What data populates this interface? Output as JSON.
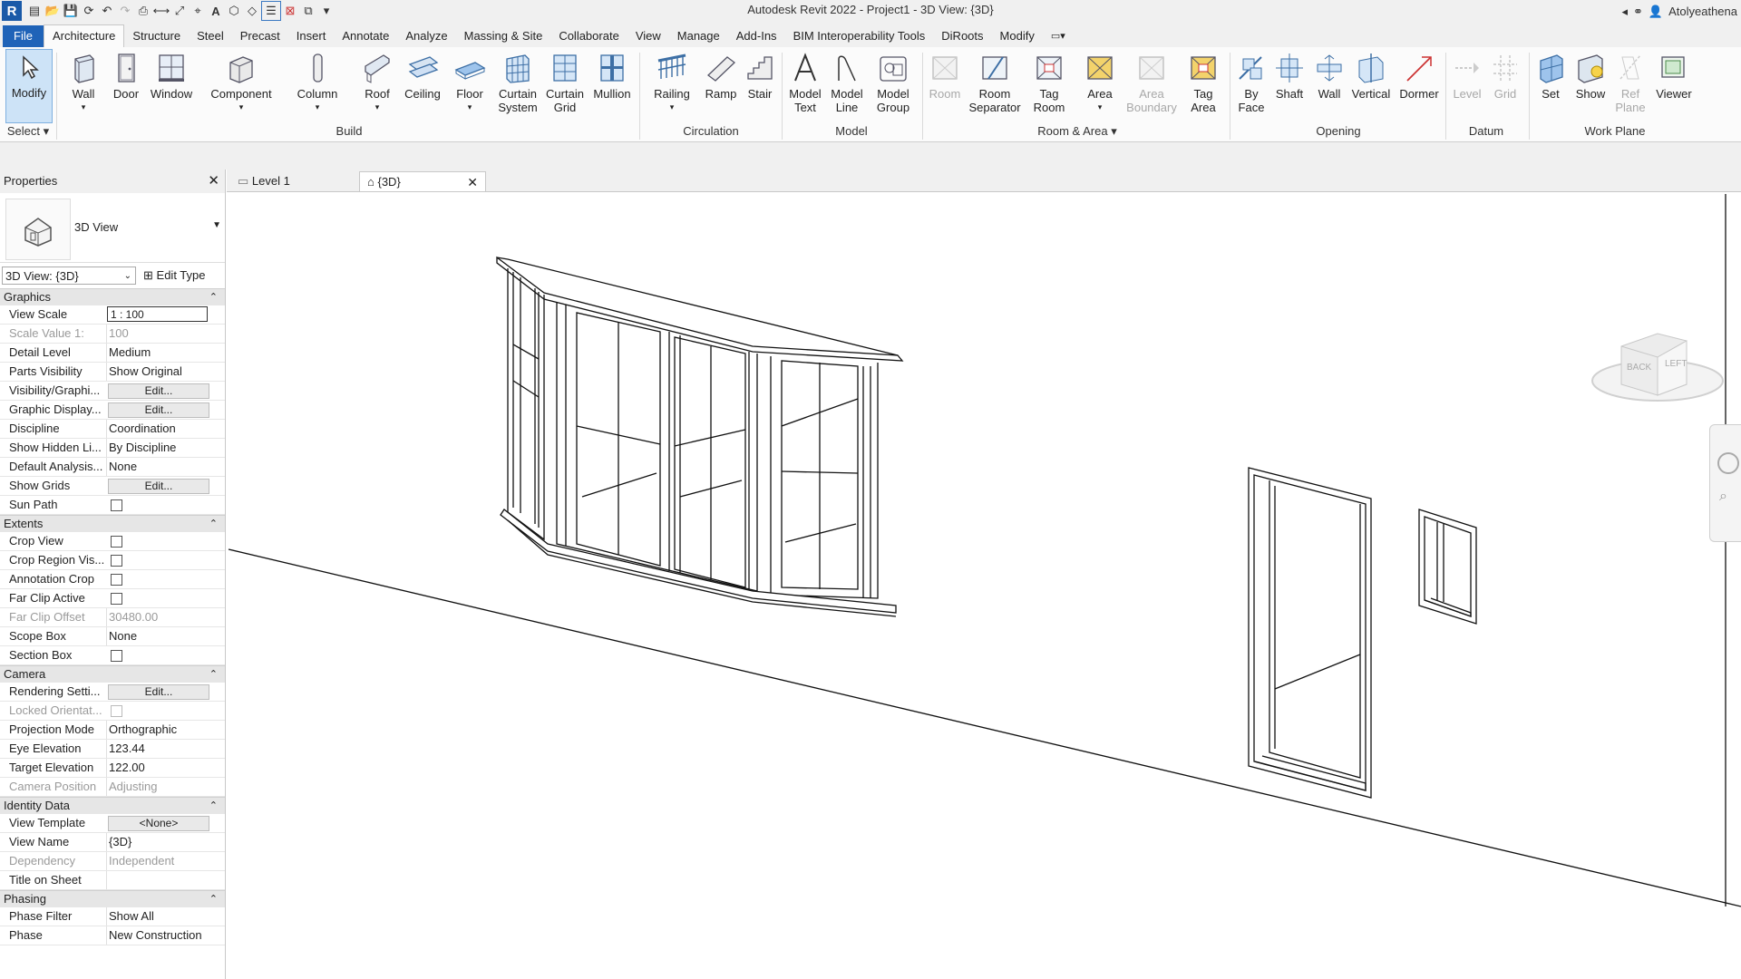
{
  "app": {
    "title": "Autodesk Revit 2022 - Project1 - 3D View: {3D}",
    "user": "Atolyeathena",
    "logo": "R"
  },
  "colors": {
    "file_tab": "#1f63b8",
    "accent": "#1a5aa8",
    "selected": "#cde3f7"
  },
  "ribbon_tabs": [
    "File",
    "Architecture",
    "Structure",
    "Steel",
    "Precast",
    "Insert",
    "Annotate",
    "Analyze",
    "Massing & Site",
    "Collaborate",
    "View",
    "Manage",
    "Add-Ins",
    "BIM Interoperability Tools",
    "DiRoots",
    "Modify"
  ],
  "ribbon": {
    "tools": {
      "modify": "Modify",
      "wall": "Wall",
      "door": "Door",
      "window": "Window",
      "component": "Component",
      "column": "Column",
      "roof": "Roof",
      "ceiling": "Ceiling",
      "floor": "Floor",
      "curtain_system": [
        "Curtain",
        "System"
      ],
      "curtain_grid": [
        "Curtain",
        "Grid"
      ],
      "mullion": "Mullion",
      "railing": "Railing",
      "ramp": "Ramp",
      "stair": "Stair",
      "model_text": [
        "Model",
        "Text"
      ],
      "model_line": [
        "Model",
        "Line"
      ],
      "model_group": [
        "Model",
        "Group"
      ],
      "room": "Room",
      "room_separator": [
        "Room",
        "Separator"
      ],
      "tag_room": [
        "Tag",
        "Room"
      ],
      "area": "Area",
      "area_boundary": [
        "Area",
        "Boundary"
      ],
      "tag_area": [
        "Tag",
        "Area"
      ],
      "by_face": [
        "By",
        "Face"
      ],
      "shaft": "Shaft",
      "opening_wall": "Wall",
      "vertical": "Vertical",
      "dormer": "Dormer",
      "level": "Level",
      "grid": "Grid",
      "set": "Set",
      "show": "Show",
      "ref_plane": [
        "Ref",
        "Plane"
      ],
      "viewer": "Viewer"
    },
    "panels": {
      "select": "Select",
      "build": "Build",
      "circulation": "Circulation",
      "model": "Model",
      "room_area": "Room & Area",
      "opening": "Opening",
      "datum": "Datum",
      "work_plane": "Work Plane"
    }
  },
  "properties": {
    "title": "Properties",
    "type_name": "3D View",
    "view_selector": "3D View: {3D}",
    "edit_type": "Edit Type",
    "sections": {
      "graphics": "Graphics",
      "extents": "Extents",
      "camera": "Camera",
      "identity": "Identity Data",
      "phasing": "Phasing"
    },
    "rows": {
      "view_scale": {
        "k": "View Scale",
        "v": "1 : 100"
      },
      "scale_value": {
        "k": "Scale Value    1:",
        "v": "100"
      },
      "detail_level": {
        "k": "Detail Level",
        "v": "Medium"
      },
      "parts_visibility": {
        "k": "Parts Visibility",
        "v": "Show Original"
      },
      "vis_graphics": {
        "k": "Visibility/Graphi...",
        "v": "Edit..."
      },
      "graphic_display": {
        "k": "Graphic Display...",
        "v": "Edit..."
      },
      "discipline": {
        "k": "Discipline",
        "v": "Coordination"
      },
      "show_hidden": {
        "k": "Show Hidden Li...",
        "v": "By Discipline"
      },
      "default_analysis": {
        "k": "Default Analysis...",
        "v": "None"
      },
      "show_grids": {
        "k": "Show Grids",
        "v": "Edit..."
      },
      "sun_path": {
        "k": "Sun Path"
      },
      "crop_view": {
        "k": "Crop View"
      },
      "crop_region": {
        "k": "Crop Region Vis..."
      },
      "annotation_crop": {
        "k": "Annotation Crop"
      },
      "far_clip_active": {
        "k": "Far Clip Active"
      },
      "far_clip_offset": {
        "k": "Far Clip Offset",
        "v": "30480.00"
      },
      "scope_box": {
        "k": "Scope Box",
        "v": "None"
      },
      "section_box": {
        "k": "Section Box"
      },
      "rendering": {
        "k": "Rendering Setti...",
        "v": "Edit..."
      },
      "locked_orient": {
        "k": "Locked Orientat..."
      },
      "projection": {
        "k": "Projection Mode",
        "v": "Orthographic"
      },
      "eye_elev": {
        "k": "Eye Elevation",
        "v": "123.44"
      },
      "target_elev": {
        "k": "Target Elevation",
        "v": "122.00"
      },
      "camera_pos": {
        "k": "Camera Position",
        "v": "Adjusting"
      },
      "view_template": {
        "k": "View Template",
        "v": "<None>"
      },
      "view_name": {
        "k": "View Name",
        "v": "{3D}"
      },
      "dependency": {
        "k": "Dependency",
        "v": "Independent"
      },
      "title_on_sheet": {
        "k": "Title on Sheet",
        "v": ""
      },
      "phase_filter": {
        "k": "Phase Filter",
        "v": "Show All"
      },
      "phase": {
        "k": "Phase",
        "v": "New Construction"
      }
    }
  },
  "view_tabs": {
    "level1": "Level 1",
    "three_d": "{3D}",
    "close": "✕"
  },
  "viewcube": {
    "back": "BACK",
    "left": "LEFT"
  }
}
